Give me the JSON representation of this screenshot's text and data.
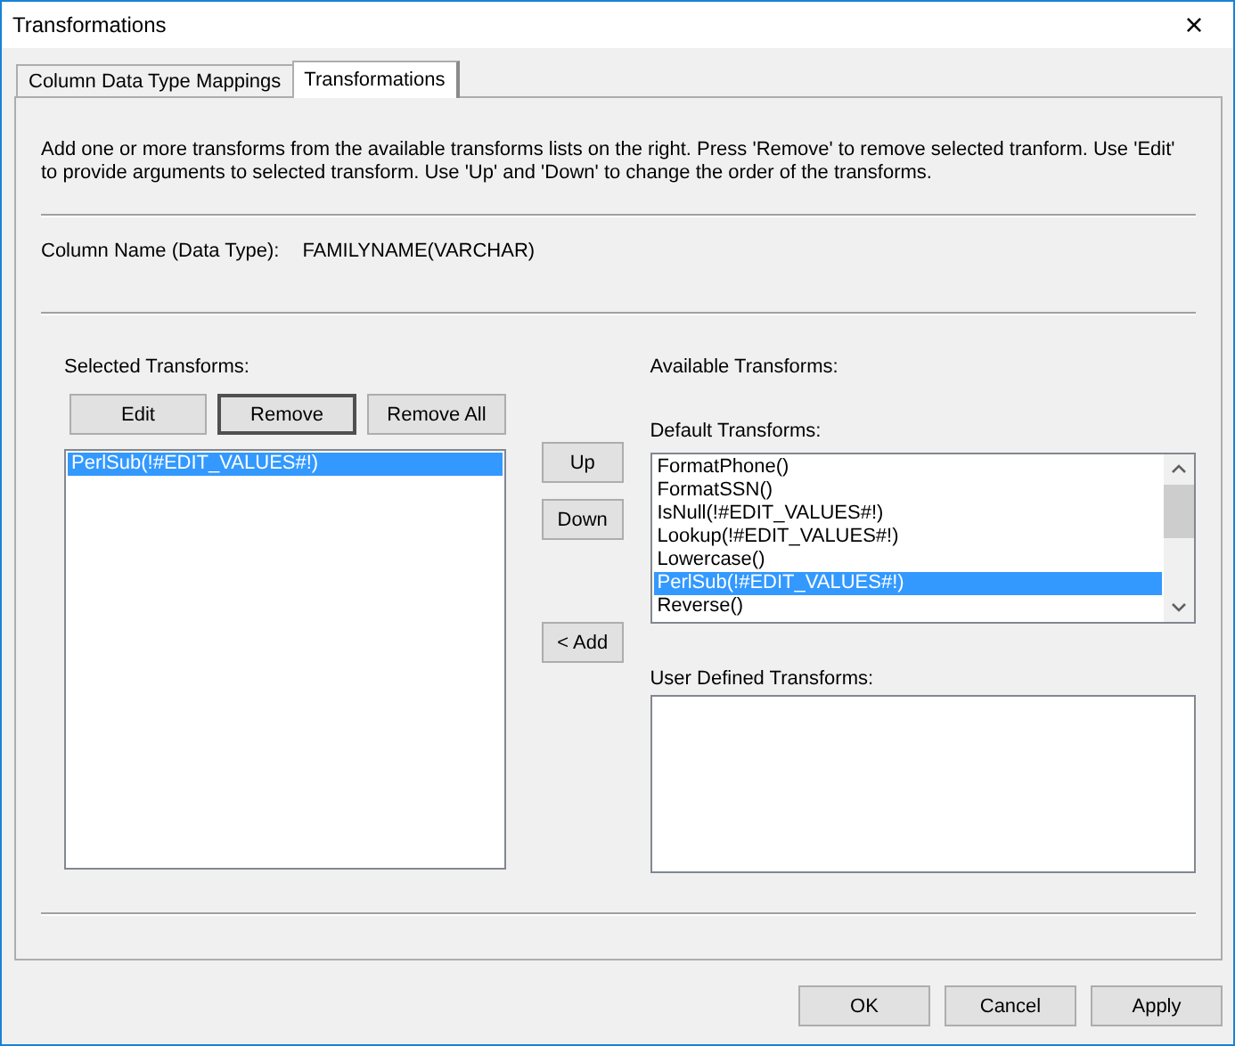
{
  "window": {
    "title": "Transformations",
    "close": "×"
  },
  "tabs": [
    {
      "label": "Column Data Type Mappings",
      "selected": false
    },
    {
      "label": "Transformations",
      "selected": true
    }
  ],
  "description": "Add one or more transforms from the available transforms lists on the right. Press 'Remove' to remove selected tranform. Use 'Edit' to provide arguments to selected transform. Use 'Up' and 'Down' to change the order of the transforms.",
  "column_name": {
    "label": "Column Name (Data Type):",
    "value": "FAMILYNAME(VARCHAR)"
  },
  "selected_transforms": {
    "label": "Selected Transforms:",
    "buttons": [
      {
        "label": "Edit",
        "default": false
      },
      {
        "label": "Remove",
        "default": true
      },
      {
        "label": "Remove All",
        "default": false
      }
    ],
    "items": [
      {
        "label": "PerlSub(!#EDIT_VALUES#!)",
        "selected": true
      }
    ]
  },
  "order_buttons": [
    "Up",
    "Down"
  ],
  "add_button": "< Add",
  "available_transforms": {
    "label": "Available Transforms:",
    "default_transforms": {
      "label": "Default Transforms:",
      "items": [
        {
          "label": "FormatPhone()",
          "selected": false
        },
        {
          "label": "FormatSSN()",
          "selected": false
        },
        {
          "label": "IsNull(!#EDIT_VALUES#!)",
          "selected": false
        },
        {
          "label": "Lookup(!#EDIT_VALUES#!)",
          "selected": false
        },
        {
          "label": "Lowercase()",
          "selected": false
        },
        {
          "label": "PerlSub(!#EDIT_VALUES#!)",
          "selected": true
        },
        {
          "label": "Reverse()",
          "selected": false
        }
      ]
    },
    "user_defined_transforms": {
      "label": "User Defined Transforms:"
    }
  },
  "dialog_buttons": [
    "OK",
    "Cancel",
    "Apply"
  ]
}
